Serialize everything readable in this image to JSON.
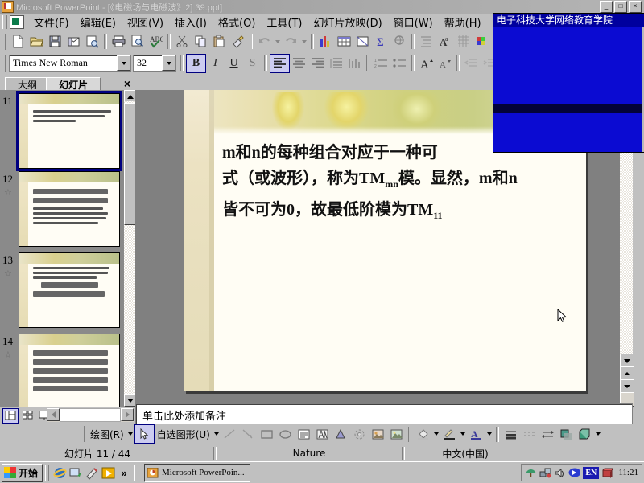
{
  "window": {
    "title": "Microsoft PowerPoint - [《电磁场与电磁波》2] 39.ppt]",
    "icon": "powerpoint-icon",
    "buttons": [
      "_",
      "□",
      "×"
    ]
  },
  "menubar": {
    "doc_icon": "document-icon",
    "items": [
      {
        "label": "文件(F)"
      },
      {
        "label": "编辑(E)"
      },
      {
        "label": "视图(V)"
      },
      {
        "label": "插入(I)"
      },
      {
        "label": "格式(O)"
      },
      {
        "label": "工具(T)"
      },
      {
        "label": "幻灯片放映(D)"
      },
      {
        "label": "窗口(W)"
      },
      {
        "label": "帮助(H)"
      }
    ]
  },
  "standard_toolbar": {
    "buttons": [
      {
        "name": "new-file-icon"
      },
      {
        "name": "open-folder-icon"
      },
      {
        "name": "save-icon"
      },
      {
        "name": "email-icon"
      },
      {
        "name": "search-file-icon"
      },
      {
        "name": "print-icon"
      },
      {
        "name": "print-preview-icon"
      },
      {
        "name": "spelling-check-icon"
      },
      {
        "name": "cut-scissors-icon"
      },
      {
        "name": "copy-icon"
      },
      {
        "name": "paste-icon"
      },
      {
        "name": "format-painter-icon"
      },
      {
        "name": "undo-icon"
      },
      {
        "name": "redo-icon"
      },
      {
        "name": "insert-chart-icon"
      },
      {
        "name": "insert-table-icon"
      },
      {
        "name": "insert-textbox-icon"
      },
      {
        "name": "sum-sigma-icon"
      },
      {
        "name": "insert-hyperlink-icon"
      },
      {
        "name": "expand-all-icon"
      },
      {
        "name": "format-text-icon"
      },
      {
        "name": "grid-icon"
      },
      {
        "name": "color-scheme-icon"
      }
    ]
  },
  "formatting_toolbar": {
    "font_name": "Times New Roman",
    "font_size": "32",
    "bold_label": "B",
    "italic_label": "I",
    "underline_label": "U",
    "shadow_label": "S",
    "buttons": [
      {
        "name": "align-left-icon",
        "active": true
      },
      {
        "name": "align-center-icon",
        "active": false
      },
      {
        "name": "align-right-icon",
        "active": false
      },
      {
        "name": "line-spacing-icon",
        "active": false
      },
      {
        "name": "text-direction-icon",
        "active": false
      },
      {
        "name": "numbered-list-icon",
        "active": false
      },
      {
        "name": "bulleted-list-icon",
        "active": false
      },
      {
        "name": "increase-font-icon",
        "active": false
      },
      {
        "name": "decrease-font-icon",
        "active": false
      },
      {
        "name": "promote-icon",
        "active": false
      },
      {
        "name": "demote-icon",
        "active": false
      }
    ]
  },
  "side_pane": {
    "tabs": [
      {
        "label": "大纲",
        "active": false
      },
      {
        "label": "幻灯片",
        "active": true
      }
    ],
    "close_label": "×",
    "thumbnails": [
      {
        "number": "11",
        "selected": true,
        "has_animation": false
      },
      {
        "number": "12",
        "selected": false,
        "has_animation": true
      },
      {
        "number": "13",
        "selected": false,
        "has_animation": true
      },
      {
        "number": "14",
        "selected": false,
        "has_animation": true
      }
    ]
  },
  "slide": {
    "line1_a": "m",
    "line1_b": "和",
    "line1_c": "n",
    "line1_d": "的每种组合对应于一种可",
    "line2_a": "式（或波形），称为",
    "line2_tm": "TM",
    "line2_sub": "mn",
    "line2_b": "模。显然，",
    "line2_c": "m",
    "line2_d": "和",
    "line2_e": "n",
    "line3_a": "皆不可为",
    "line3_zero": "0",
    "line3_b": "，故最低阶模为",
    "line3_tm": "TM",
    "line3_sub": "11",
    "cursor_icon": "mouse-pointer-icon"
  },
  "notes": {
    "placeholder": "单击此处添加备注"
  },
  "view_buttons": [
    {
      "name": "normal-view-button",
      "active": true
    },
    {
      "name": "slide-sorter-view-button",
      "active": false
    },
    {
      "name": "slide-show-button",
      "active": false
    }
  ],
  "drawing_toolbar": {
    "draw_label": "绘图(R)",
    "autoshapes_label": "自选图形(U)",
    "buttons": [
      {
        "name": "select-arrow-icon",
        "active": true
      },
      {
        "name": "line-icon"
      },
      {
        "name": "arrow-icon"
      },
      {
        "name": "rectangle-icon"
      },
      {
        "name": "oval-icon"
      },
      {
        "name": "textbox-icon"
      },
      {
        "name": "wordart-icon"
      },
      {
        "name": "diagram-icon"
      },
      {
        "name": "clipart-icon"
      },
      {
        "name": "insert-picture-icon"
      },
      {
        "name": "fill-color-icon"
      },
      {
        "name": "line-color-icon"
      },
      {
        "name": "font-color-icon"
      },
      {
        "name": "line-style-icon"
      },
      {
        "name": "dash-style-icon"
      },
      {
        "name": "arrow-style-icon"
      },
      {
        "name": "shadow-style-icon"
      },
      {
        "name": "3d-style-icon"
      }
    ]
  },
  "statusbar": {
    "slide_counter": "幻灯片 11 / 44",
    "design_template": "Nature",
    "language": "中文(中国)"
  },
  "taskbar": {
    "start_label": "开始",
    "quick_launch": [
      {
        "name": "internet-explorer-icon"
      },
      {
        "name": "show-desktop-icon"
      },
      {
        "name": "media-player-icon"
      },
      {
        "name": "play-icon"
      },
      {
        "name": "more-chevron-icon",
        "label": "»"
      }
    ],
    "tasks": [
      {
        "label": "Microsoft PowerPoin...",
        "icon": "powerpoint-icon",
        "active": true
      }
    ],
    "tray": [
      {
        "name": "antivirus-icon"
      },
      {
        "name": "network-icon"
      },
      {
        "name": "volume-icon"
      },
      {
        "name": "ime-icon"
      },
      {
        "name": "language-indicator",
        "label": "EN"
      },
      {
        "name": "books-icon"
      }
    ],
    "clock": "11:21"
  },
  "video_window": {
    "title": "电子科技大学网络教育学院"
  },
  "colors": {
    "desktop": "#c0c0c0",
    "titlebar_inactive": "#9a9a9a",
    "selection_blue": "#000080",
    "video_blue": "#0b0bd2",
    "slide_paper": "#fffdf4"
  }
}
